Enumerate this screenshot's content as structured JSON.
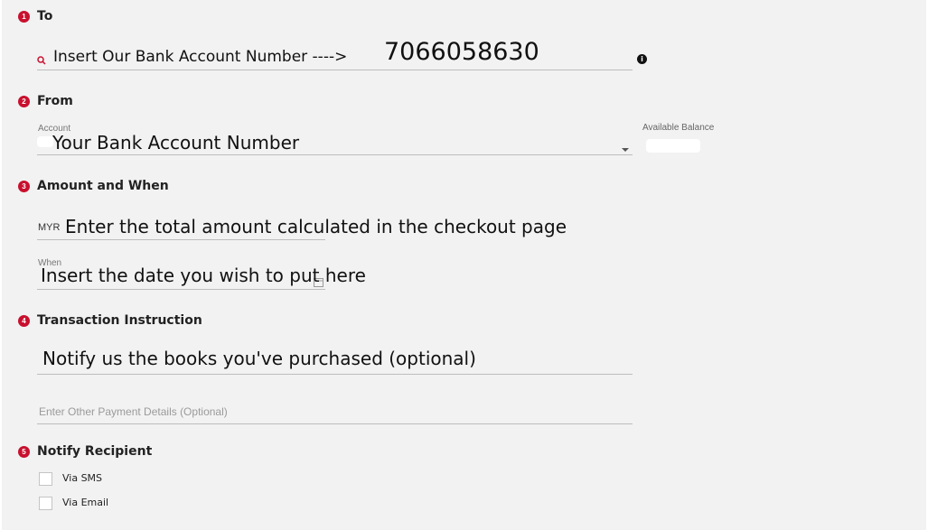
{
  "steps": [
    {
      "number": "1",
      "title": "To"
    },
    {
      "number": "2",
      "title": "From"
    },
    {
      "number": "3",
      "title": "Amount and When"
    },
    {
      "number": "4",
      "title": "Transaction Instruction"
    },
    {
      "number": "5",
      "title": "Notify Recipient"
    }
  ],
  "to": {
    "overlay_text": "Insert Our Bank Account Number ---->",
    "account_number": "7066058630"
  },
  "from": {
    "account_label": "Account",
    "overlay_text": "Your Bank Account Number",
    "available_balance_label": "Available Balance"
  },
  "amount": {
    "currency": "MYR",
    "overlay_text": "Enter the total amount calculated in the checkout page",
    "when_label": "When",
    "when_overlay_text": "Insert the date you wish to put here"
  },
  "instruction": {
    "overlay_text": "Notify us the books you've purchased (optional)",
    "other_details_placeholder": "Enter Other Payment Details (Optional)"
  },
  "notify": {
    "options": [
      "Via SMS",
      "Via Email"
    ]
  },
  "colors": {
    "accent": "#c8102e",
    "background": "#f2f2f2"
  }
}
